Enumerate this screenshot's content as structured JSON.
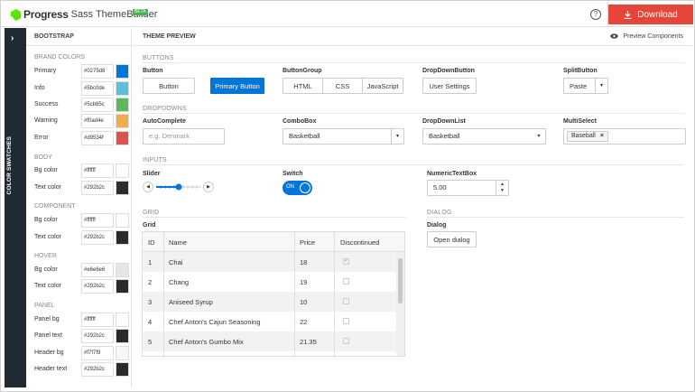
{
  "header": {
    "brand": "Progress",
    "product": "Sass ThemeBuilder",
    "badge": "BETA",
    "help_label": "?",
    "download_label": "Download"
  },
  "strip": {
    "toggle_glyph": "›",
    "label": "COLOR SWATCHES"
  },
  "swatches": {
    "title": "BOOTSTRAP",
    "groups": [
      {
        "title": "BRAND COLORS",
        "items": [
          {
            "label": "Primary",
            "value": "#0275d8",
            "color": "#0275d8"
          },
          {
            "label": "Info",
            "value": "#5bc0de",
            "color": "#5bc0de"
          },
          {
            "label": "Success",
            "value": "#5cb85c",
            "color": "#5cb85c"
          },
          {
            "label": "Warning",
            "value": "#f0ad4e",
            "color": "#f0ad4e"
          },
          {
            "label": "Error",
            "value": "#d9534f",
            "color": "#d9534f"
          }
        ]
      },
      {
        "title": "BODY",
        "items": [
          {
            "label": "Bg color",
            "value": "#ffffff",
            "color": "#ffffff"
          },
          {
            "label": "Text color",
            "value": "#292b2c",
            "color": "#292b2c"
          }
        ]
      },
      {
        "title": "COMPONENT",
        "items": [
          {
            "label": "Bg color",
            "value": "#ffffff",
            "color": "#ffffff"
          },
          {
            "label": "Text color",
            "value": "#292b2c",
            "color": "#292b2c"
          }
        ]
      },
      {
        "title": "HOVER",
        "items": [
          {
            "label": "Bg color",
            "value": "#e6e6e6",
            "color": "#e6e6e6"
          },
          {
            "label": "Text color",
            "value": "#292b2c",
            "color": "#292b2c"
          }
        ]
      },
      {
        "title": "PANEL",
        "items": [
          {
            "label": "Panel bg",
            "value": "#ffffff",
            "color": "#ffffff"
          },
          {
            "label": "Panel text",
            "value": "#292b2c",
            "color": "#292b2c"
          },
          {
            "label": "Header bg",
            "value": "#f7f7f9",
            "color": "#f7f7f9"
          },
          {
            "label": "Header text",
            "value": "#292b2c",
            "color": "#292b2c"
          }
        ]
      }
    ]
  },
  "preview": {
    "title": "THEME PREVIEW",
    "toggle_label": "Preview Components",
    "sections": {
      "buttons": "BUTTONS",
      "dropdowns": "DROPDOWNS",
      "inputs": "INPUTS",
      "grid": "GRID",
      "dialog": "DIALOG"
    },
    "button": {
      "label": "Button",
      "default_text": "Button",
      "primary_text": "Primary Button"
    },
    "button_group": {
      "label": "ButtonGroup",
      "items": [
        "HTML",
        "CSS",
        "JavaScript"
      ]
    },
    "dropdown_button": {
      "label": "DropDownButton",
      "text": "User Settings"
    },
    "split_button": {
      "label": "SplitButton",
      "text": "Paste",
      "arrow": "▾"
    },
    "autocomplete": {
      "label": "AutoComplete",
      "placeholder": "e.g. Denmark"
    },
    "combobox": {
      "label": "ComboBox",
      "value": "Basketball"
    },
    "dropdownlist": {
      "label": "DropDownList",
      "value": "Basketball"
    },
    "multiselect": {
      "label": "MultiSelect",
      "tag": "Baseball",
      "remove": "×"
    },
    "slider": {
      "label": "Slider",
      "value_fraction": 0.5
    },
    "switch": {
      "label": "Switch",
      "state_text": "ON"
    },
    "numeric": {
      "label": "NumericTextBox",
      "value": "5.00"
    },
    "grid": {
      "label": "Grid",
      "columns": [
        "ID",
        "Name",
        "Price",
        "Discontinued"
      ],
      "rows": [
        {
          "id": "1",
          "name": "Chai",
          "price": "18",
          "checked": true
        },
        {
          "id": "2",
          "name": "Chang",
          "price": "19",
          "checked": false
        },
        {
          "id": "3",
          "name": "Aniseed Syrup",
          "price": "10",
          "checked": false
        },
        {
          "id": "4",
          "name": "Chef Anton's Cajun Seasoning",
          "price": "22",
          "checked": false
        },
        {
          "id": "5",
          "name": "Chef Anton's Gumbo Mix",
          "price": "21.35",
          "checked": false
        }
      ]
    },
    "dialog": {
      "label": "Dialog",
      "button_text": "Open dialog"
    }
  }
}
